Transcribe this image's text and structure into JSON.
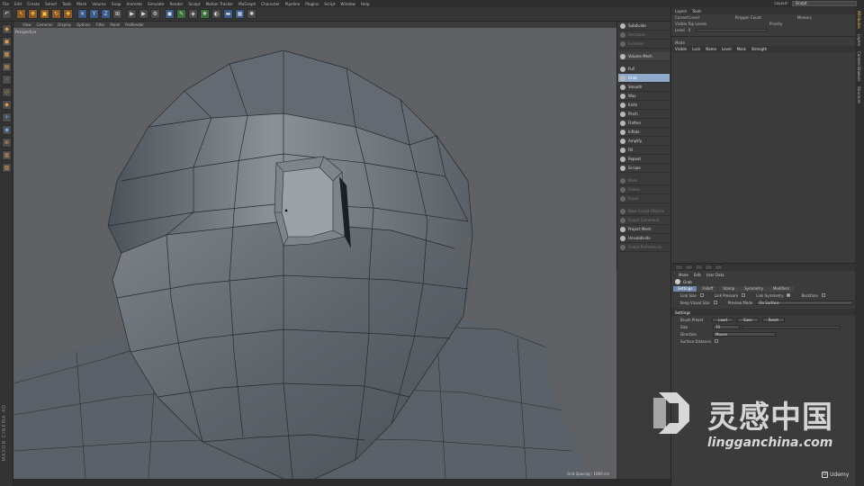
{
  "menu": [
    "File",
    "Edit",
    "Create",
    "Select",
    "Tools",
    "Mesh",
    "Volume",
    "Snap",
    "Animate",
    "Simulate",
    "Render",
    "Sculpt",
    "Motion Tracker",
    "MoGraph",
    "Character",
    "Pipeline",
    "Plugins",
    "Script",
    "Window",
    "Help"
  ],
  "layout": {
    "label": "Layout:",
    "value": "Sculpt"
  },
  "viewport": {
    "menu": [
      "View",
      "Cameras",
      "Display",
      "Options",
      "Filter",
      "Panel",
      "ProRender"
    ],
    "label": "Perspective",
    "grid_spacing": "Grid Spacing : 1000 cm"
  },
  "sculpt_tools": {
    "top": [
      {
        "label": "Subdivide",
        "dim": false
      },
      {
        "label": "Decrease",
        "dim": true
      },
      {
        "label": "Increase",
        "dim": true
      }
    ],
    "volume": "Volume Mesh",
    "brushes": [
      {
        "label": "Pull",
        "active": false
      },
      {
        "label": "Grab",
        "active": true
      },
      {
        "label": "Smooth",
        "active": false
      },
      {
        "label": "Wax",
        "active": false
      },
      {
        "label": "Knife",
        "active": false
      },
      {
        "label": "Pinch",
        "active": false
      },
      {
        "label": "Flatten",
        "active": false
      },
      {
        "label": "Inflate",
        "active": false
      },
      {
        "label": "Amplify",
        "active": false
      },
      {
        "label": "Fill",
        "active": false
      },
      {
        "label": "Repeat",
        "active": false
      },
      {
        "label": "Scrape",
        "active": false
      }
    ],
    "mid": [
      "Mask",
      "Freeze",
      "Erase"
    ],
    "bottom": [
      {
        "label": "Bake Sculpt Objects",
        "dim": true
      },
      {
        "label": "Sculpt Command",
        "dim": true
      },
      {
        "label": "Project Mesh",
        "dim": false
      },
      {
        "label": "Unsubdivide",
        "dim": false
      },
      {
        "label": "Sculpt Preferences",
        "dim": true
      }
    ]
  },
  "layers_panel": {
    "tabs": [
      "Layers",
      "Tools"
    ],
    "header_cols": [
      "Current Level",
      "Polygon Count",
      "Memory"
    ],
    "options": [
      "Visible Top Levels",
      "Priority"
    ],
    "level_label": "Level",
    "level_value": "0",
    "mode_label": "Mode",
    "columns": [
      "Visible",
      "Lock",
      "Name",
      "Level",
      "Mask",
      "Strength"
    ]
  },
  "attributes": {
    "menu": [
      "Mode",
      "Edit",
      "User Data"
    ],
    "title": "Grab",
    "tabs": [
      {
        "label": "Settings",
        "on": true
      },
      {
        "label": "Falloff",
        "on": false
      },
      {
        "label": "Stamp",
        "on": false
      },
      {
        "label": "Symmetry",
        "on": false
      },
      {
        "label": "Modifiers",
        "on": false
      }
    ],
    "row1": {
      "link_size": "Link Size",
      "link_pressure": "Link Pressure",
      "link_symmetry": "Link Symmetry",
      "backface": "Backface"
    },
    "row2": {
      "keep_visual": "Keep Visual Size",
      "preview_mode": "Preview Mode",
      "preview_value": "On Surface"
    },
    "section": "Settings",
    "brush_preset": {
      "label": "Brush Preset",
      "load": "Load",
      "save": "Save",
      "reset": "Reset"
    },
    "size": {
      "label": "Size",
      "value": "70"
    },
    "direction": {
      "label": "Direction",
      "value": "Mouse"
    },
    "surface": {
      "label": "Surface Distance"
    }
  },
  "side_tabs": [
    "Attributes",
    "Layers",
    "Content Browser",
    "Structure"
  ],
  "brand": "MAXON CINEMA 4D",
  "watermark": {
    "cn": "灵感中国",
    "url": "lingganchina.com"
  },
  "udemy": "Udemy"
}
